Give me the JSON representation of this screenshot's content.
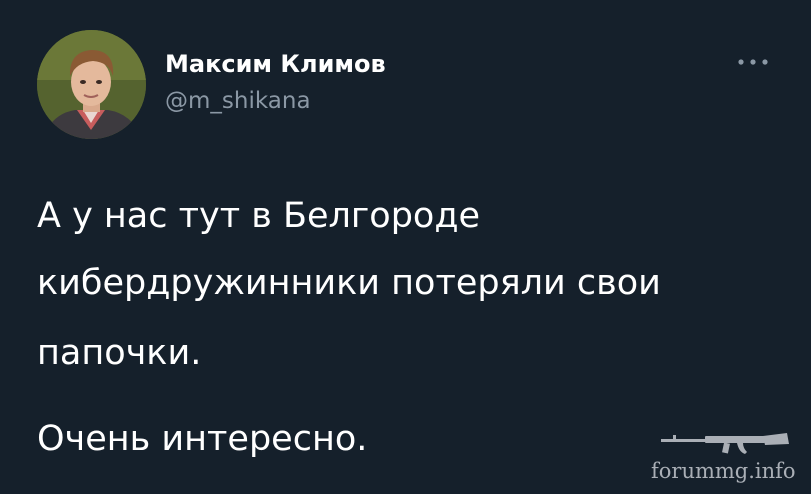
{
  "tweet": {
    "author": {
      "display_name": "Максим Климов",
      "handle": "@m_shikana",
      "avatar_icon": "person-avatar"
    },
    "more_icon": "more-dots-icon",
    "text_lines": [
      "А у нас тут в Белгороде",
      "кибердружинники потеряли свои",
      "папочки.",
      "Очень интересно."
    ]
  },
  "watermark": {
    "text": "forummg.info",
    "icon": "rifle-icon"
  },
  "colors": {
    "background": "#15202b",
    "primary_text": "#ffffff",
    "secondary_text": "#8b98a5"
  }
}
